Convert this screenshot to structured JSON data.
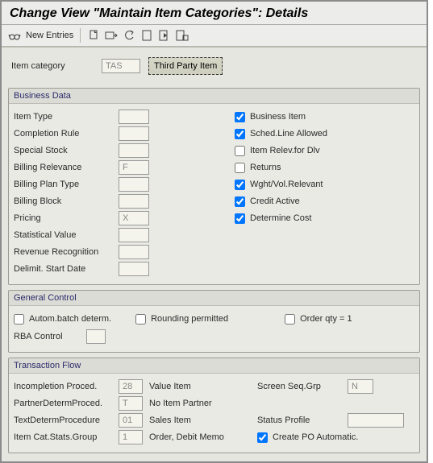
{
  "title": "Change View \"Maintain Item Categories\": Details",
  "toolbar": {
    "new_entries": "New Entries"
  },
  "key": {
    "item_category_label": "Item category",
    "item_category_value": "TAS",
    "item_category_desc": "Third Party Item"
  },
  "sections": {
    "business_data": {
      "header": "Business Data",
      "fields": {
        "item_type": {
          "label": "Item Type",
          "value": ""
        },
        "completion_rule": {
          "label": "Completion Rule",
          "value": ""
        },
        "special_stock": {
          "label": "Special Stock",
          "value": ""
        },
        "billing_relevance": {
          "label": "Billing Relevance",
          "value": "F"
        },
        "billing_plan_type": {
          "label": "Billing Plan Type",
          "value": ""
        },
        "billing_block": {
          "label": "Billing Block",
          "value": ""
        },
        "pricing": {
          "label": "Pricing",
          "value": "X"
        },
        "statistical_value": {
          "label": "Statistical Value",
          "value": ""
        },
        "revenue_recog": {
          "label": "Revenue Recognition",
          "value": ""
        },
        "delimit_start": {
          "label": "Delimit. Start Date",
          "value": ""
        }
      },
      "checks": {
        "business_item": {
          "label": "Business Item",
          "checked": true
        },
        "sched_line": {
          "label": "Sched.Line Allowed",
          "checked": true
        },
        "item_relev_dlv": {
          "label": "Item Relev.for Dlv",
          "checked": false
        },
        "returns": {
          "label": "Returns",
          "checked": false
        },
        "wght_vol": {
          "label": "Wght/Vol.Relevant",
          "checked": true
        },
        "credit_active": {
          "label": "Credit Active",
          "checked": true
        },
        "determine_cost": {
          "label": "Determine Cost",
          "checked": true
        }
      }
    },
    "general_control": {
      "header": "General Control",
      "checks": {
        "autom_batch": {
          "label": "Autom.batch determ.",
          "checked": false
        },
        "rounding": {
          "label": "Rounding permitted",
          "checked": false
        },
        "order_qty1": {
          "label": "Order qty = 1",
          "checked": false
        }
      },
      "fields": {
        "rba_control": {
          "label": "RBA Control",
          "value": ""
        }
      }
    },
    "transaction_flow": {
      "header": "Transaction Flow",
      "rows": {
        "r1": {
          "lbl": "Incompletion Proced.",
          "val": "28",
          "lbl2": "Value Item",
          "lbl3": "Screen Seq.Grp",
          "val3": "N"
        },
        "r2": {
          "lbl": "PartnerDetermProced.",
          "val": "T",
          "lbl2": "No Item Partner",
          "lbl3": "",
          "val3": ""
        },
        "r3": {
          "lbl": "TextDetermProcedure",
          "val": "01",
          "lbl2": "Sales Item",
          "lbl3": "Status Profile",
          "val3": ""
        },
        "r4": {
          "lbl": "Item Cat.Stats.Group",
          "val": "1",
          "lbl2": "Order, Debit Memo",
          "check_label": "Create PO Automatic.",
          "checked": true
        }
      }
    }
  }
}
